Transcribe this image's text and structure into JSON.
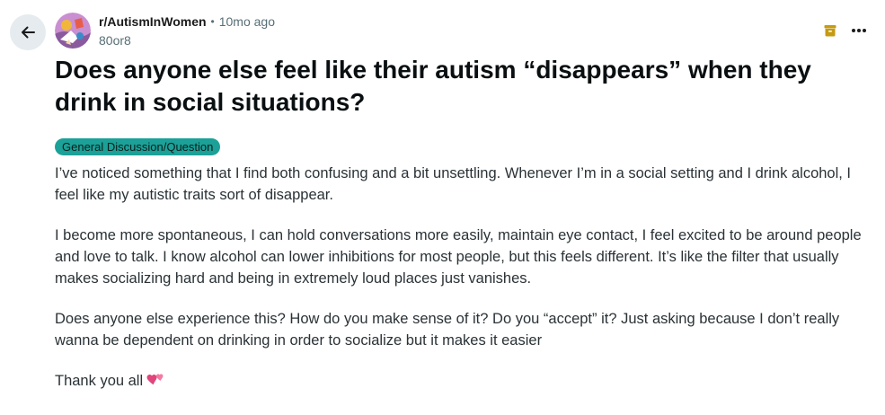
{
  "header": {
    "subreddit": "r/AutismInWomen",
    "separator": "•",
    "timestamp": "10mo ago",
    "username": "80or8"
  },
  "icons": {
    "back": "arrow-left-icon",
    "avatar": "subreddit-avatar",
    "archive": "archive-icon",
    "more": "ellipsis-icon"
  },
  "colors": {
    "back_button_bg": "#e5ebee",
    "flair_bg": "#1ba197",
    "archive_icon": "#c69b12",
    "meta_text": "#576f76"
  },
  "post": {
    "title": "Does anyone else feel like their autism “disappears” when they drink in social situations?",
    "flair": "General Discussion/Question",
    "paragraphs": [
      "I’ve noticed something that I find both confusing and a bit unsettling. Whenever I’m in a social setting and I drink alcohol, I feel like my autistic traits sort of disappear.",
      "I become more spontaneous, I can hold conversations more easily, maintain eye contact, I feel excited to be around people and love to talk. I know alcohol can lower inhibitions for most people, but this feels different. It’s like the filter that usually makes socializing hard and being in extremely loud places just vanishes.",
      "Does anyone else experience this? How do you make sense of it? Do you “accept” it? Just asking because I don’t really wanna be dependent on drinking in order to socialize but it makes it easier",
      "Thank you all"
    ],
    "closing_emoji": "two-hearts-emoji"
  }
}
